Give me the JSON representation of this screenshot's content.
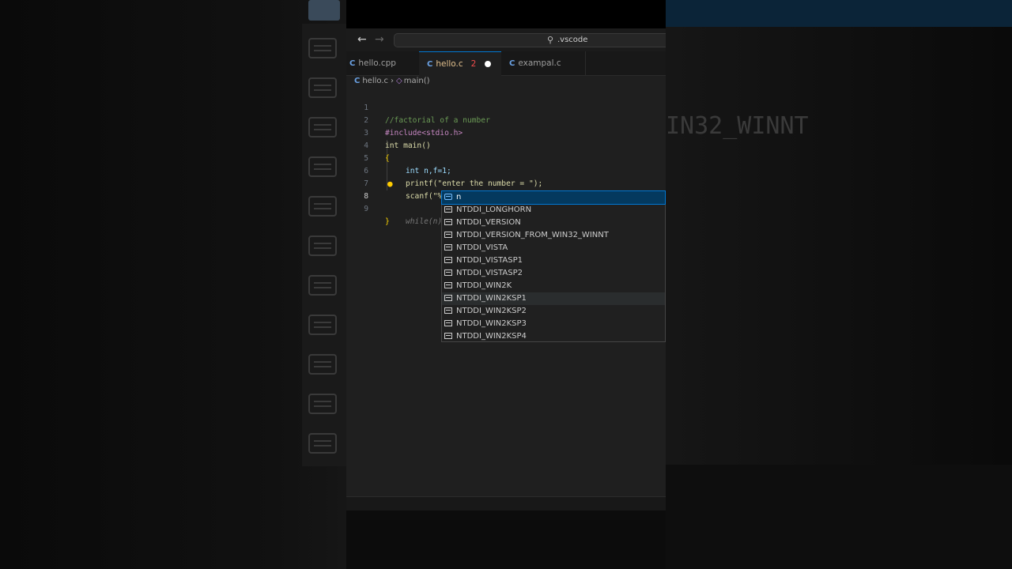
{
  "window": {
    "command_center_label": ".vscode",
    "search_icon": "search-icon"
  },
  "tabs": [
    {
      "icon": "C",
      "label": "hello.cpp"
    },
    {
      "icon": "C",
      "label": "hello.c",
      "problems": "2",
      "dirty": true
    },
    {
      "icon": "C",
      "label": "exampal.c"
    }
  ],
  "breadcrumb": {
    "file": "hello.c",
    "symbol": "main()"
  },
  "code": {
    "lines": [
      {
        "n": "1",
        "text": "//factorial of a number"
      },
      {
        "n": "2",
        "text": "#include<stdio.h>"
      },
      {
        "n": "3",
        "text": "int main()"
      },
      {
        "n": "4",
        "text": "{"
      },
      {
        "n": "5",
        "text": "int n,f=1;"
      },
      {
        "n": "6",
        "text": "printf(\"enter the number = \");"
      },
      {
        "n": "7",
        "text": "scanf(\"%d\",&n);"
      },
      {
        "n": "8",
        "text": "while(n)"
      },
      {
        "n": "9",
        "text": "}"
      }
    ],
    "active_line": "8"
  },
  "suggestions": [
    {
      "label": "n",
      "kind": "variable",
      "selected": true
    },
    {
      "label": "NTDDI_LONGHORN",
      "kind": "constant"
    },
    {
      "label": "NTDDI_VERSION",
      "kind": "constant"
    },
    {
      "label": "NTDDI_VERSION_FROM_WIN32_WINNT",
      "kind": "constant"
    },
    {
      "label": "NTDDI_VISTA",
      "kind": "constant"
    },
    {
      "label": "NTDDI_VISTASP1",
      "kind": "constant"
    },
    {
      "label": "NTDDI_VISTASP2",
      "kind": "constant"
    },
    {
      "label": "NTDDI_WIN2K",
      "kind": "constant"
    },
    {
      "label": "NTDDI_WIN2KSP1",
      "kind": "constant",
      "hover": true
    },
    {
      "label": "NTDDI_WIN2KSP2",
      "kind": "constant"
    },
    {
      "label": "NTDDI_WIN2KSP3",
      "kind": "constant"
    },
    {
      "label": "NTDDI_WIN2KSP4",
      "kind": "constant"
    }
  ],
  "background": {
    "right_ghost_text": "IN32_WINNT"
  }
}
